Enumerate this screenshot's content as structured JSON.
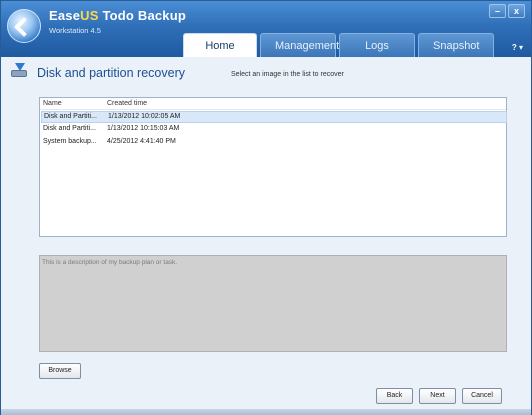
{
  "app": {
    "brand_prefix": "Ease",
    "brand_us": "US",
    "brand_suffix": " Todo Backup",
    "edition": "Workstation 4.5"
  },
  "window_controls": {
    "minimize": "–",
    "close": "x"
  },
  "tabs": [
    {
      "label": "Home",
      "active": true
    },
    {
      "label": "Management",
      "active": false
    },
    {
      "label": "Logs",
      "active": false
    },
    {
      "label": "Snapshot",
      "active": false
    }
  ],
  "help_label": "? ▾",
  "page": {
    "title": "Disk and partition recovery",
    "hint": "Select an image in the list to recover"
  },
  "list": {
    "columns": [
      "Name",
      "Created time"
    ],
    "rows": [
      {
        "name": "Disk and Partiti...",
        "time": "1/13/2012 10:02:05 AM",
        "selected": true
      },
      {
        "name": "Disk and Partiti...",
        "time": "1/13/2012 10:15:03 AM",
        "selected": false
      },
      {
        "name": "System backup...",
        "time": "4/25/2012 4:41:40 PM",
        "selected": false
      }
    ]
  },
  "description": "This is a description of my backup plan or task.",
  "buttons": {
    "browse": "Browse",
    "back": "Back",
    "next": "Next",
    "cancel": "Cancel"
  },
  "colors": {
    "header_blue": "#2f6fb8",
    "title_blue": "#1d4f93",
    "selection": "#d9e8f8"
  }
}
